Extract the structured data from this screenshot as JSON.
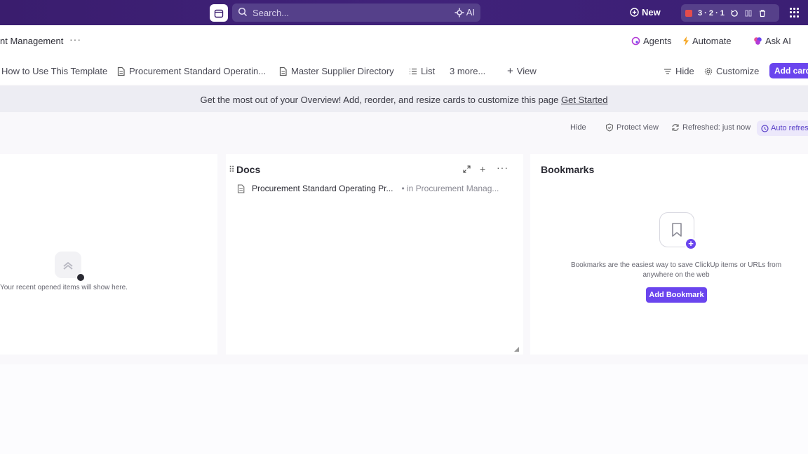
{
  "topbar": {
    "search_placeholder": "Search...",
    "ai_label": "AI",
    "new_label": "New",
    "recording": "3 · 2 · 1",
    "colors": {
      "bg": "#3a1d6e",
      "accent": "#6a45ee"
    }
  },
  "header": {
    "title": "nt Management",
    "agents": "Agents",
    "automate": "Automate",
    "ask_ai": "Ask AI"
  },
  "tabs": {
    "items": [
      {
        "label": "How to Use This Template"
      },
      {
        "label": "Procurement Standard Operatin..."
      },
      {
        "label": "Master Supplier Directory"
      },
      {
        "label": "List"
      },
      {
        "label": "3 more..."
      },
      {
        "label": "View"
      }
    ],
    "hide": "Hide",
    "customize": "Customize",
    "add_card": "Add card"
  },
  "banner": {
    "text": "Get the most out of your Overview! Add, reorder, and resize cards to customize this page",
    "link": "Get Started"
  },
  "toolbar": {
    "hide": "Hide",
    "protect": "Protect view",
    "refreshed": "Refreshed: just now",
    "auto_refresh": "Auto refresh"
  },
  "recent": {
    "empty_text": "Your recent opened items will show here."
  },
  "docs": {
    "title": "Docs",
    "items": [
      {
        "name": "Procurement Standard Operating Pr...",
        "location": "• in Procurement Manag..."
      }
    ]
  },
  "bookmarks": {
    "title": "Bookmarks",
    "empty_text": "Bookmarks are the easiest way to save ClickUp items or URLs from anywhere on the web",
    "add_button": "Add Bookmark"
  }
}
